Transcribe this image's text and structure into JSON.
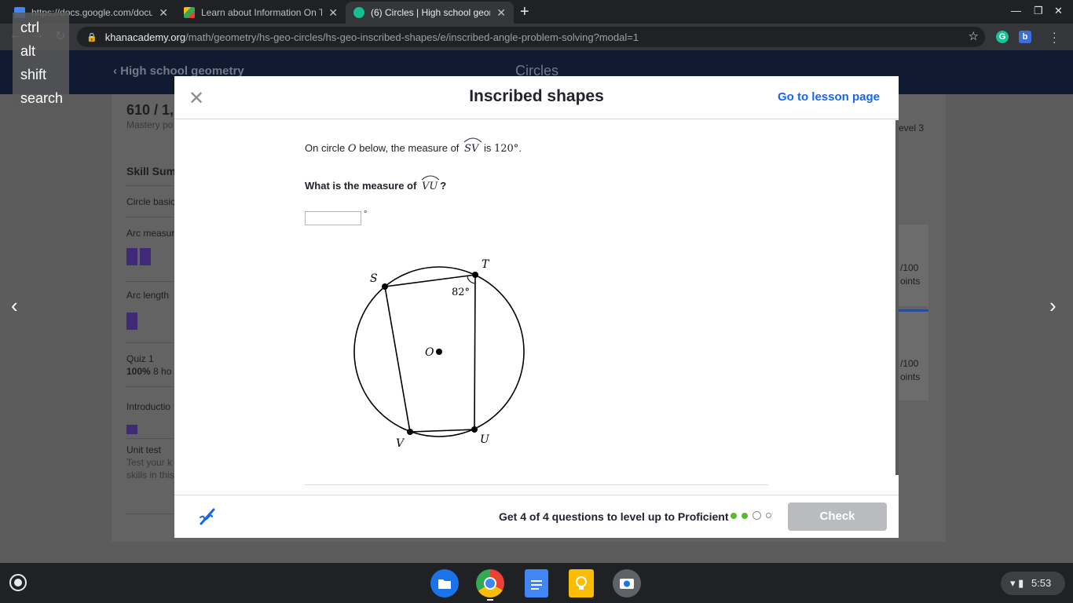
{
  "browser": {
    "tabs": [
      {
        "title": "https://docs.google.com/docum",
        "active": false
      },
      {
        "title": "Learn about Information On The",
        "active": false
      },
      {
        "title": "(6) Circles | High school geomet",
        "active": true
      }
    ],
    "url_host": "khanacademy.org",
    "url_path": "/math/geometry/hs-geo-circles/hs-geo-inscribed-shapes/e/inscribed-angle-problem-solving?modal=1"
  },
  "keyboard_overlay": [
    "ctrl",
    "alt",
    "shift",
    "search"
  ],
  "background_page": {
    "breadcrumb": "High school geometry",
    "header_title": "Circles",
    "points": "610 / 1,",
    "mastery": "Mastery po",
    "skill_summary": "Skill Summ",
    "items": [
      "Circle basic",
      "Arc measur",
      "Arc length"
    ],
    "quiz": "Quiz 1",
    "quiz_score": "100%",
    "quiz_time": "8 ho",
    "intro": "Introductio",
    "unit_test": "Unit test",
    "unit_test_desc1": "Test your k",
    "unit_test_desc2": "skills in this",
    "level": "evel 3",
    "right_points1": "/100",
    "right_points1b": "oints",
    "right_points2": "/100",
    "right_points2b": "oints"
  },
  "modal": {
    "title": "Inscribed shapes",
    "go_to_lesson": "Go to lesson page",
    "question_line1_pre": "On circle",
    "question_circle_name": "O",
    "question_line1_mid": "below, the measure of",
    "given_arc": "SV",
    "question_line1_is": "is",
    "given_measure": "120°",
    "question_line1_end": ".",
    "question_line2_pre": "What is the measure of",
    "asked_arc": "VU",
    "question_line2_end": "?",
    "answer_value": "",
    "degree_symbol": "°",
    "figure": {
      "labels": {
        "S": "S",
        "T": "T",
        "U": "U",
        "V": "V",
        "O": "O"
      },
      "angle_label": "82°"
    },
    "footer_message": "Get 4 of 4 questions to level up to Proficient",
    "progress": {
      "completed": 2,
      "current": 1,
      "remaining": 1
    },
    "check_label": "Check"
  },
  "shelf": {
    "apps": [
      "files-icon",
      "chrome-icon",
      "docs-icon",
      "keep-icon",
      "camera-icon"
    ],
    "time": "5:53"
  },
  "colors": {
    "link": "#1865f2",
    "progress_done": "#5cb82f",
    "check_disabled": "#b9bbbe",
    "mastery_bar": "#402a78"
  }
}
